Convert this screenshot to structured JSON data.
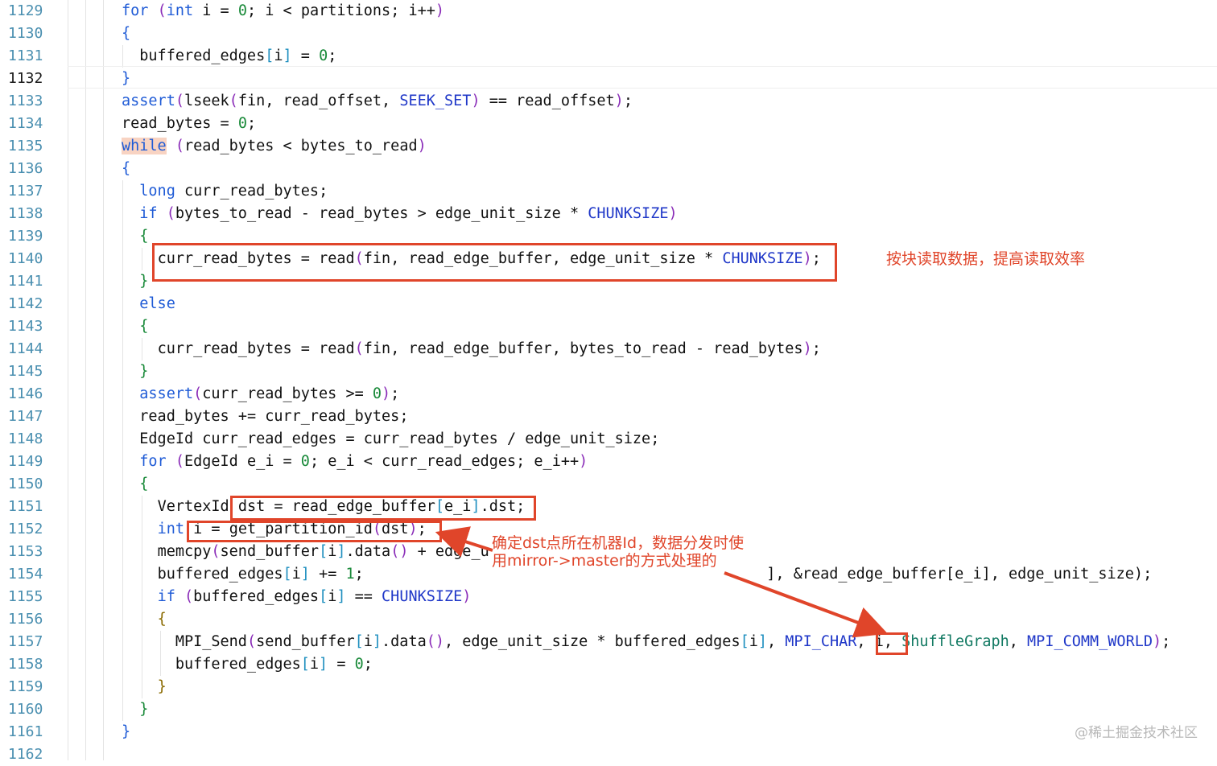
{
  "editor": {
    "line_numbers": [
      "1129",
      "1130",
      "1131",
      "1132",
      "1133",
      "1134",
      "1135",
      "1136",
      "1137",
      "1138",
      "1139",
      "1140",
      "1141",
      "1142",
      "1143",
      "1144",
      "1145",
      "1146",
      "1147",
      "1148",
      "1149",
      "1150",
      "1151",
      "1152",
      "1153",
      "1154",
      "1155",
      "1156",
      "1157",
      "1158",
      "1159",
      "1160",
      "1161",
      "1162"
    ],
    "active_line": "1132",
    "code_lines": [
      "for (int i = 0; i < partitions; i++)",
      "{",
      "  buffered_edges[i] = 0;",
      "}",
      "assert(lseek(fin, read_offset, SEEK_SET) == read_offset);",
      "read_bytes = 0;",
      "while (read_bytes < bytes_to_read)",
      "{",
      "  long curr_read_bytes;",
      "  if (bytes_to_read - read_bytes > edge_unit_size * CHUNKSIZE)",
      "  {",
      "    curr_read_bytes = read(fin, read_edge_buffer, edge_unit_size * CHUNKSIZE);",
      "  }",
      "  else",
      "  {",
      "    curr_read_bytes = read(fin, read_edge_buffer, bytes_to_read - read_bytes);",
      "  }",
      "  assert(curr_read_bytes >= 0);",
      "  read_bytes += curr_read_bytes;",
      "  EdgeId curr_read_edges = curr_read_bytes / edge_unit_size;",
      "  for (EdgeId e_i = 0; e_i < curr_read_edges; e_i++)",
      "  {",
      "    VertexId dst = read_edge_buffer[e_i].dst;",
      "    int i = get_partition_id(dst);",
      "    memcpy(send_buffer[i].data() + edge_u",
      "    buffered_edges[i] += 1;",
      "    if (buffered_edges[i] == CHUNKSIZE)",
      "    {",
      "      MPI_Send(send_buffer[i].data(), edge_unit_size * buffered_edges[i], MPI_CHAR, i, ShuffleGraph, MPI_COMM_WORLD);",
      "      buffered_edges[i] = 0;",
      "    }",
      "  }",
      "}"
    ],
    "line_1153_tail": "], &read_edge_buffer[e_i], edge_unit_size);"
  },
  "annotations": {
    "chunk_read_note": "按块读取数据，提高读取效率",
    "dst_note_line1": "确定dst点所在机器Id，数据分发时使",
    "dst_note_line2": "用mirror->master的方式处理的"
  },
  "watermark": "@稀土掘金技术社区",
  "colors": {
    "keyword": "#1f5bd6",
    "number": "#1a8a3a",
    "line_number": "#4a8fb0",
    "annotation": "#e0452a",
    "while_highlight": "#f8d3c2"
  }
}
